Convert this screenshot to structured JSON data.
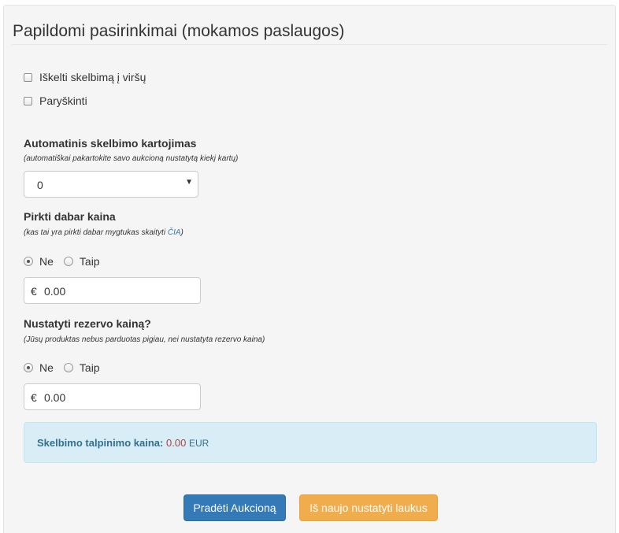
{
  "section": {
    "title": "Papildomi pasirinkimai (mokamos paslaugos)"
  },
  "options": {
    "highlight_top": {
      "label": "Iškelti skelbimą į viršų",
      "checked": false
    },
    "bold": {
      "label": "Paryškinti",
      "checked": false
    }
  },
  "auto_repeat": {
    "label": "Automatinis skelbimo kartojimas",
    "hint": "(automatiškai pakartokite savo aukcioną nustatytą kiekį kartų)",
    "selected": "0"
  },
  "buy_now": {
    "label": "Pirkti dabar kaina",
    "hint_prefix": "(kas tai yra pirkti dabar mygtukas skaityti ",
    "hint_link": "ČIA",
    "hint_suffix": ")",
    "radio_no": "Ne",
    "radio_yes": "Taip",
    "selected": "Ne",
    "currency": "€",
    "value": "0.00"
  },
  "reserve": {
    "label": "Nustatyti rezervo kainą?",
    "hint": "(Jūsų produktas nebus parduotas pigiau, nei nustatyta rezervo kaina)",
    "radio_no": "Ne",
    "radio_yes": "Taip",
    "selected": "Ne",
    "currency": "€",
    "value": "0.00"
  },
  "fee": {
    "label": "Skelbimo talpinimo kaina:",
    "amount": "0.00",
    "currency": "EUR"
  },
  "buttons": {
    "start": "Pradėti Aukcioną",
    "reset": "Iš naujo nustatyti laukus"
  },
  "colors": {
    "primary": "#337ab7",
    "warning": "#f0ad4e",
    "info_bg": "#d9edf7",
    "info_text": "#31708f",
    "amount_red": "#a94442"
  }
}
